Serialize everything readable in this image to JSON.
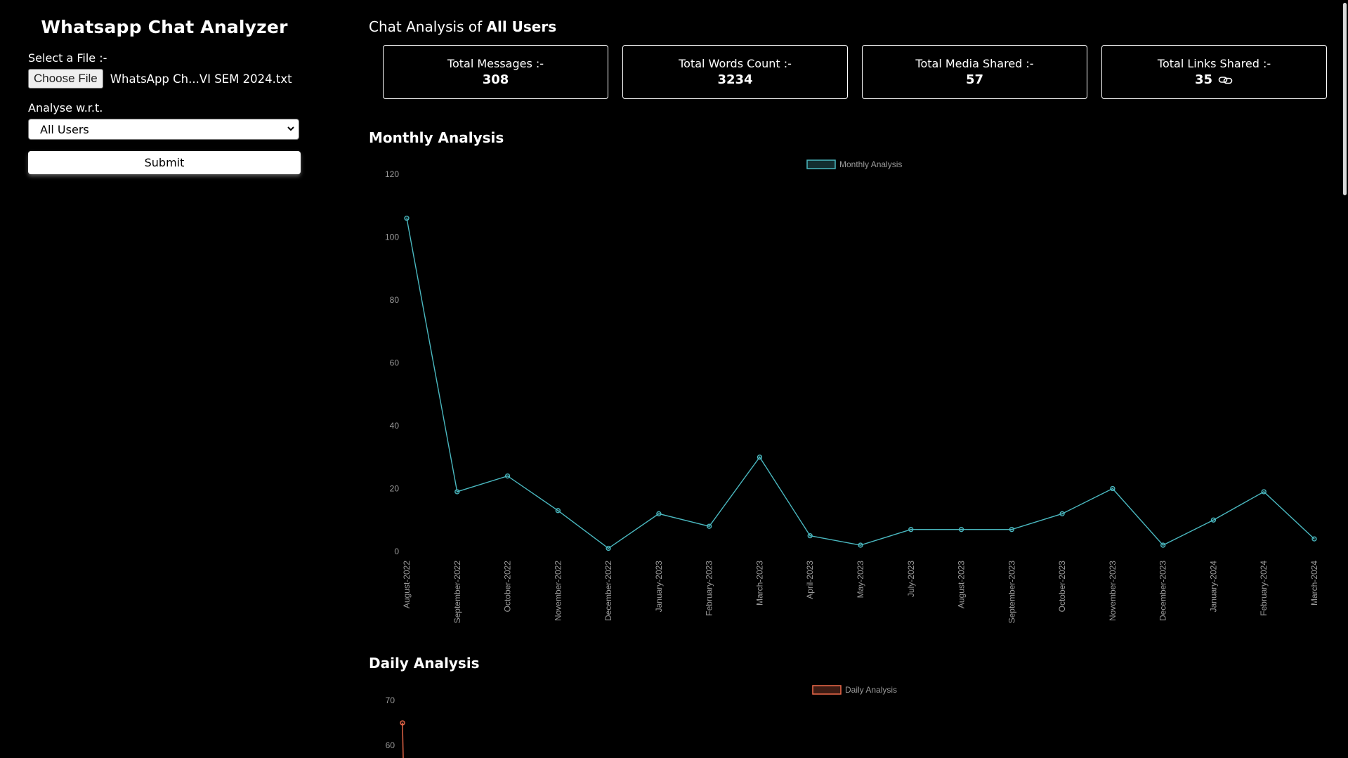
{
  "sidebar": {
    "app_title": "Whatsapp Chat Analyzer",
    "file_label": "Select a File :-",
    "file_button": "Choose File",
    "file_name": "WhatsApp Ch...VI SEM 2024.txt",
    "analyse_label": "Analyse w.r.t.",
    "select_value": "All Users",
    "submit_label": "Submit"
  },
  "main": {
    "heading_prefix": "Chat Analysis of",
    "heading_user": "All Users",
    "cards": [
      {
        "label": "Total Messages :-",
        "value": "308"
      },
      {
        "label": "Total Words Count :-",
        "value": "3234"
      },
      {
        "label": "Total Media Shared :-",
        "value": "57"
      },
      {
        "label": "Total Links Shared :-",
        "value": "35"
      }
    ],
    "monthly_title": "Monthly Analysis",
    "daily_title": "Daily Analysis"
  },
  "colors": {
    "monthly_line": "#4ab8c0",
    "daily_line": "#f06a4a",
    "axis_text": "#9a9a9a"
  },
  "chart_data": [
    {
      "type": "line",
      "legend": "Monthly Analysis",
      "categories": [
        "August-2022",
        "September-2022",
        "October-2022",
        "November-2022",
        "December-2022",
        "January-2023",
        "February-2023",
        "March-2023",
        "April-2023",
        "May-2023",
        "July-2023",
        "August-2023",
        "September-2023",
        "October-2023",
        "November-2023",
        "December-2023",
        "January-2024",
        "February-2024",
        "March-2024"
      ],
      "values": [
        106,
        19,
        24,
        13,
        1,
        12,
        8,
        30,
        5,
        2,
        7,
        7,
        7,
        12,
        20,
        2,
        10,
        19,
        4
      ],
      "yticks": [
        0,
        20,
        40,
        60,
        80,
        100,
        120
      ],
      "ylim": [
        0,
        120
      ],
      "legend_position": "top"
    },
    {
      "type": "line",
      "legend": "Daily Analysis",
      "yticks": [
        60,
        70
      ],
      "values": [
        65
      ],
      "legend_position": "top"
    }
  ]
}
